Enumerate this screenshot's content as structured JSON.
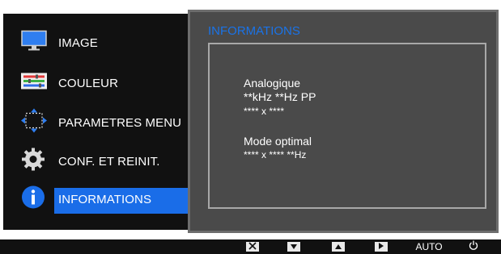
{
  "menu": {
    "items": [
      {
        "label": "IMAGE",
        "icon": "monitor-icon"
      },
      {
        "label": "COULEUR",
        "icon": "color-adjust-icon"
      },
      {
        "label": "PARAMETRES MENU",
        "icon": "menu-position-icon"
      },
      {
        "label": "CONF. ET REINIT.",
        "icon": "gear-icon"
      },
      {
        "label": "INFORMATIONS",
        "icon": "info-icon",
        "selected": true
      }
    ]
  },
  "info": {
    "title": "INFORMATIONS",
    "signal_type": "Analogique",
    "frequency": "**kHz **Hz PP",
    "resolution": "**** x ****",
    "optimal_mode_label": "Mode optimal",
    "optimal_mode_value": "**** x **** **Hz"
  },
  "buttons": {
    "close_icon": "close-icon",
    "down_icon": "down-arrow-icon",
    "up_icon": "up-arrow-icon",
    "enter_icon": "right-arrow-icon",
    "auto_label": "AUTO",
    "power_icon": "power-icon"
  },
  "colors": {
    "accent": "#1a6de8",
    "title_blue": "#1a73e8",
    "panel": "#4a4a4a",
    "menu_bg": "#111111"
  }
}
